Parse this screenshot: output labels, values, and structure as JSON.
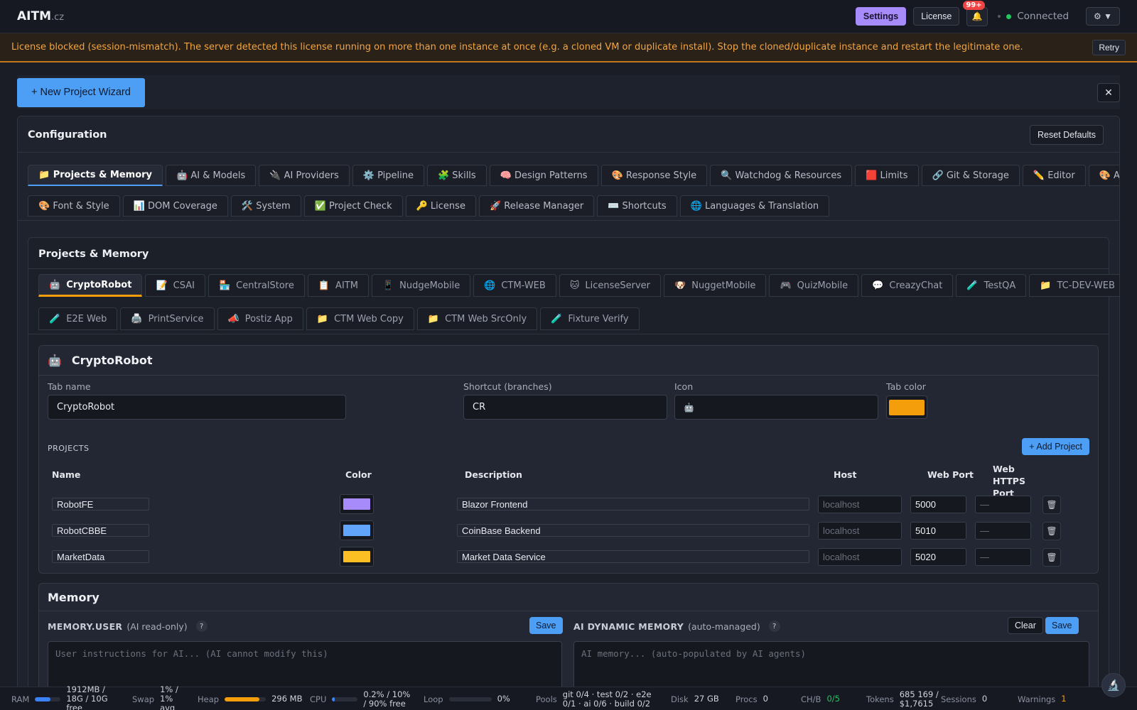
{
  "app": {
    "logo": "AITM",
    "logo_tld": ".cz"
  },
  "topbar": {
    "settings_label": "Settings",
    "license_label": "License",
    "notifications_badge": "99+",
    "status_text": "Connected",
    "gear_label": "⚙ ▼"
  },
  "banner": {
    "message": "License blocked (session-mismatch). The server detected this license running on more than one instance at once (e.g. a cloned VM or duplicate install). Stop the cloned/duplicate instance and restart the legitimate one.",
    "retry_label": "Retry"
  },
  "wizard": {
    "new_project_label": "+ New Project Wizard",
    "close_label": "✕"
  },
  "config": {
    "title": "Configuration",
    "reset_label": "Reset Defaults",
    "tabs_row1": [
      "📁 Projects & Memory",
      "🤖 AI & Models",
      "🔌 AI Providers",
      "⚙️ Pipeline",
      "🧩 Skills",
      "🧠 Design Patterns",
      "🎨 Response Style",
      "🔍 Watchdog & Resources",
      "🟥 Limits",
      "🔗 Git & Storage",
      "✏️ Editor",
      "🎨 Appearance"
    ],
    "tabs_row2": [
      "🎨 Font & Style",
      "📊 DOM Coverage",
      "🛠️ System",
      "✅ Project Check",
      "🔑 License",
      "🚀 Release Manager",
      "⌨️ Shortcuts",
      "🌐 Languages & Translation"
    ],
    "active_tab": "📁 Projects & Memory"
  },
  "projects_memory": {
    "title": "Projects & Memory",
    "subtabs_row1": [
      {
        "icon": "🤖",
        "label": "CryptoRobot"
      },
      {
        "icon": "📝",
        "label": "CSAI"
      },
      {
        "icon": "🏪",
        "label": "CentralStore"
      },
      {
        "icon": "📋",
        "label": "AITM"
      },
      {
        "icon": "📱",
        "label": "NudgeMobile"
      },
      {
        "icon": "🌐",
        "label": "CTM-WEB"
      },
      {
        "icon": "🐱",
        "label": "LicenseServer"
      },
      {
        "icon": "🐶",
        "label": "NuggetMobile"
      },
      {
        "icon": "🎮",
        "label": "QuizMobile"
      },
      {
        "icon": "💬",
        "label": "CreazyChat"
      },
      {
        "icon": "🧪",
        "label": "TestQA"
      },
      {
        "icon": "📁",
        "label": "TC-DEV-WEB"
      }
    ],
    "subtabs_row2": [
      {
        "icon": "🧪",
        "label": "E2E Web"
      },
      {
        "icon": "🖨️",
        "label": "PrintService"
      },
      {
        "icon": "📣",
        "label": "Postiz App"
      },
      {
        "icon": "📁",
        "label": "CTM Web Copy"
      },
      {
        "icon": "📁",
        "label": "CTM Web SrcOnly"
      },
      {
        "icon": "🧪",
        "label": "Fixture Verify"
      }
    ],
    "active_subtab": "CryptoRobot"
  },
  "project_card": {
    "icon": "🤖",
    "title": "CryptoRobot",
    "tab_name_label": "Tab name",
    "tab_name_value": "CryptoRobot",
    "shortcut_label": "Shortcut (branches)",
    "shortcut_value": "CR",
    "icon_label": "Icon",
    "icon_value": "🤖",
    "tab_color_label": "Tab color",
    "tab_color": "#f59e0b",
    "projects_label": "PROJECTS",
    "add_project_label": "+ Add Project",
    "columns": [
      "Name",
      "Color",
      "Description",
      "Host",
      "Web Port",
      "Web HTTPS Port"
    ],
    "rows": [
      {
        "name": "RobotFE",
        "color": "#a78bfa",
        "description": "Blazor Frontend",
        "host_placeholder": "localhost",
        "web_port": "5000",
        "https_placeholder": "—"
      },
      {
        "name": "RobotCBBE",
        "color": "#60a5fa",
        "description": "CoinBase Backend",
        "host_placeholder": "localhost",
        "web_port": "5010",
        "https_placeholder": "—"
      },
      {
        "name": "MarketData",
        "color": "#fbbf24",
        "description": "Market Data Service",
        "host_placeholder": "localhost",
        "web_port": "5020",
        "https_placeholder": "—"
      }
    ]
  },
  "memory": {
    "title": "Memory",
    "user_label": "MEMORY.USER",
    "user_note": "(AI read-only)",
    "user_help": "?",
    "user_save": "Save",
    "user_placeholder": "User instructions for AI... (AI cannot modify this)",
    "ai_label": "AI DYNAMIC MEMORY",
    "ai_note": "(auto-managed)",
    "ai_help": "?",
    "ai_clear": "Clear",
    "ai_save": "Save",
    "ai_placeholder": "AI memory... (auto-populated by AI agents)"
  },
  "statusbar": {
    "ram_label": "RAM",
    "ram_value": "1912MB / 18G / 10G free",
    "ram_fill": 0.6,
    "swap_label": "Swap",
    "swap_value": "1% / 1% avg",
    "heap_label": "Heap",
    "heap_value": "296 MB",
    "heap_fill": 0.85,
    "cpu_label": "CPU",
    "cpu_value": "0.2% / 10% / 90% free",
    "cpu_fill": 0.1,
    "loop_label": "Loop",
    "loop_value": "0%",
    "loop_fill": 0.0,
    "pools_label": "Pools",
    "pools_value": "git 0/4 · test 0/2 · e2e 0/1 · ai 0/6 · build 0/2",
    "disk_label": "Disk",
    "disk_value": "27 GB",
    "procs_label": "Procs",
    "procs_value": "0",
    "chb_label": "CH/B",
    "chb_value": "0/5",
    "tokens_label": "Tokens",
    "tokens_value": "685 169 / $1,7615",
    "sessions_label": "Sessions",
    "sessions_value": "0",
    "warnings_label": "Warnings",
    "warnings_value": "1",
    "colors": {
      "ram": "#3b82f6",
      "heap": "#f59e0b",
      "cpu": "#3b82f6",
      "chb": "#22c55e",
      "warn": "#f59e0b"
    }
  }
}
